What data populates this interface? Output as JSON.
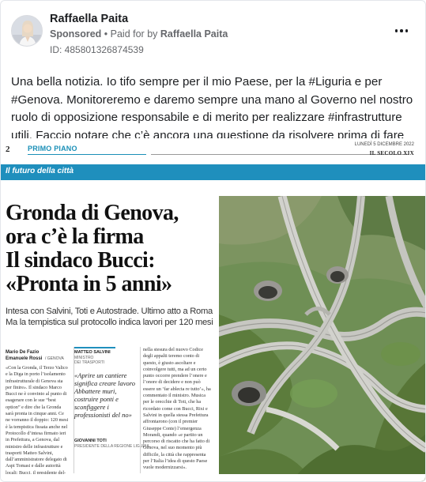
{
  "post": {
    "advertiser": "Raffaella Paita",
    "sponsored": "Sponsored",
    "paid_for_prefix": "Paid for by",
    "paid_for_name": "Raffaella Paita",
    "ad_id": "ID: 485801326874539",
    "body": "Una bella notizia. Io tifo sempre per il mio Paese, per la #Liguria e per #Genova. Monitoreremo e daremo sempre una mano al Governo nel nostro ruolo di opposizione responsabile e di merito per realizzare #infrastrutture utili. Faccio notare che c’è ancora una questione da risolvere prima di fare proclami: i costi.",
    "more_icon": "more-options-icon"
  },
  "newspaper": {
    "page_number": "2",
    "section": "PRIMO PIANO",
    "date": "LUNEDÌ 5 DICEMBRE 2022",
    "paper_name": "IL SECOLO XIX",
    "band_title": "Il futuro della città",
    "headline_lines": [
      "Gronda di Genova,",
      "ora c’è la firma",
      "Il sindaco Bucci:",
      "«Pronta in 5 anni»"
    ],
    "subhead_lines": [
      "Intesa con Salvini, Toti e Autostrade. Ultimo atto a Roma",
      "Ma la tempistica sul protocollo indica lavori per 120 mesi"
    ],
    "byline_1": "Mario De Fazio",
    "byline_2": "Emanuele Rossi",
    "byline_role": "/ GENOVA",
    "col1_text": "«Con la Gronda, il Terzo Valico e la Diga in porto l’isolamento infrastrutturale di Genova sta per finire». Il sindaco Marco Bucci ne è convinto al punto di esagerare con le sue “best option” e dire che la Gronda sarà pronta in cinque anni. Ce ne vorranno il doppio: 120 mesi è la tempistica fissata anche nel Protocollo d’intesa firmato ieri in Prefettura, a Genova, dal ministro delle infrastrutture e trasporti Matteo Salvini, dall’amministratore delegato di Aspi Tomasi e dalle autorità locali: Bucci, il presidente del-",
    "quote1_name": "MATTEO SALVINI",
    "quote1_role_a": "MINISTRO",
    "quote1_role_b": "DEI TRASPORTI",
    "quote1_text": "«Aprire un cantiere significa creare lavoro Abbattere muri, costruire ponti e sconfiggere i professionisti del no»",
    "quote2_name": "GIOVANNI TOTI",
    "quote2_role": "PRESIDENTE DELLA REGIONE LIGURIA",
    "col3_text": "nella stesura del nuovo Codice degli appalti teremo conto di questo, è giusto ascoltare e coinvolgere tutti, ma ad un certo punto occorre prendere l’onere e l’onore di decidere e non può essere un ‘far ablecta re tutto’», ha commentato il ministro. Musica per le orecchie di Toti, che ha ricordato come con Bucci, Rixi e Salvini in quella stessa Prefettura affrontarono (con il premier Giuseppe Conte) l’emergenza Morandi, quando «e partito un percorso di riscatto che ha fatto di Genova, nel suo momento più difficile, la città che rappresenta per l’Italia l’idea di questo Paese vuole modernizzarsi»."
  },
  "colors": {
    "accent": "#1f8fbd",
    "text": "#1c1e21",
    "muted": "#65676b"
  }
}
